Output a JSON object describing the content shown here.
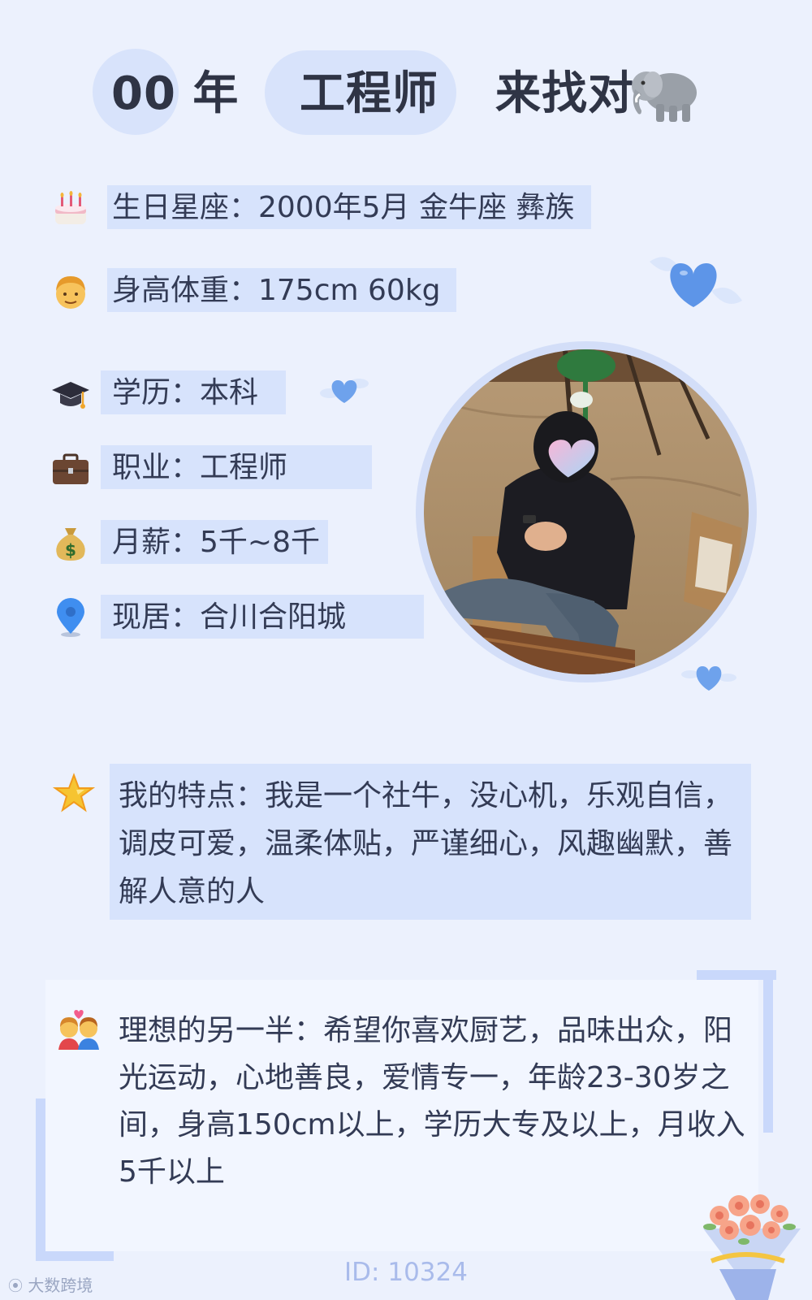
{
  "header": {
    "part1": "00 年",
    "part2": "工程师",
    "part3": "来找对",
    "emoji": "elephant-icon"
  },
  "info": [
    {
      "icon": "birthday-cake-icon",
      "text": "生日星座：2000年5月 金牛座 彝族"
    },
    {
      "icon": "man-face-icon",
      "text": "身高体重：175cm 60kg"
    },
    {
      "icon": "graduation-cap-icon",
      "text": "学历：本科"
    },
    {
      "icon": "briefcase-icon",
      "text": "职业：工程师"
    },
    {
      "icon": "money-bag-icon",
      "text": "月薪：5千~8千"
    },
    {
      "icon": "location-pin-icon",
      "text": "现居：合川合阳城"
    }
  ],
  "features": {
    "icon": "star-icon",
    "text": "我的特点：我是一个社牛，没心机，乐观自信，调皮可爱，温柔体贴，严谨细心，风趣幽默，善解人意的人"
  },
  "ideal": {
    "icon": "couple-with-heart-icon",
    "text": "理想的另一半：希望你喜欢厨艺，品味出众，阳光运动，心地善良，爱情专一，年龄23-30岁之间，身高150cm以上，学历大专及以上，月收入5千以上"
  },
  "footer": {
    "id": "ID: 10324",
    "watermark": "大数跨境"
  },
  "colors": {
    "background": "#ecf1fd",
    "highlight": "#d7e3fc",
    "heart": "#5d95e8"
  }
}
